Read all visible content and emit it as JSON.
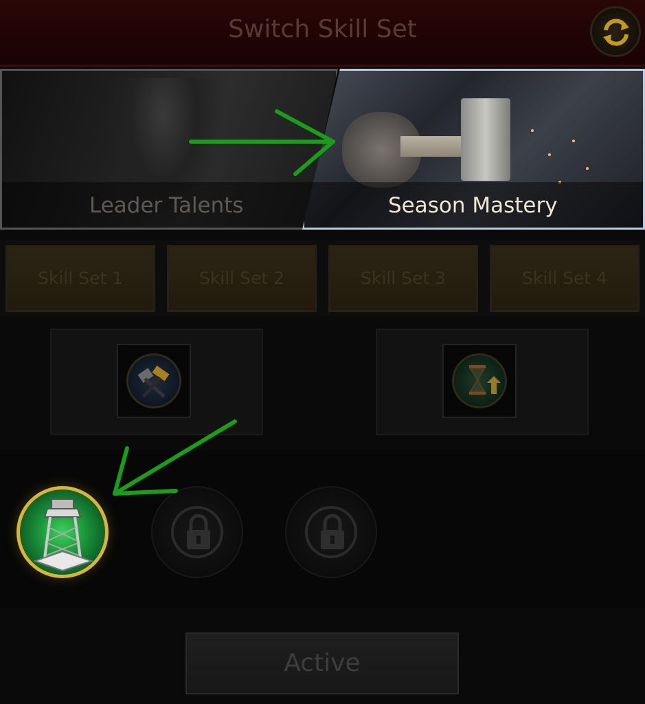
{
  "header": {
    "title": "Switch Skill Set",
    "refresh_icon": "refresh-icon"
  },
  "tabs": [
    {
      "label": "Leader Talents",
      "selected": false
    },
    {
      "label": "Season Mastery",
      "selected": true
    }
  ],
  "skill_sets": [
    {
      "label": "Skill Set 1"
    },
    {
      "label": "Skill Set 2"
    },
    {
      "label": "Skill Set 3"
    },
    {
      "label": "Skill Set 4"
    }
  ],
  "skills": [
    {
      "icon": "hammer-tools-icon"
    },
    {
      "icon": "hourglass-upgrade-icon"
    }
  ],
  "slots": [
    {
      "icon": "watchtower-icon",
      "state": "active"
    },
    {
      "icon": "lock-icon",
      "state": "locked"
    },
    {
      "icon": "lock-icon",
      "state": "locked"
    }
  ],
  "footer": {
    "button_label": "Active"
  },
  "colors": {
    "annotation_arrow": "#1a9e1a",
    "gold_ring": "#d8b43a",
    "header_bg": "#2a0606"
  }
}
